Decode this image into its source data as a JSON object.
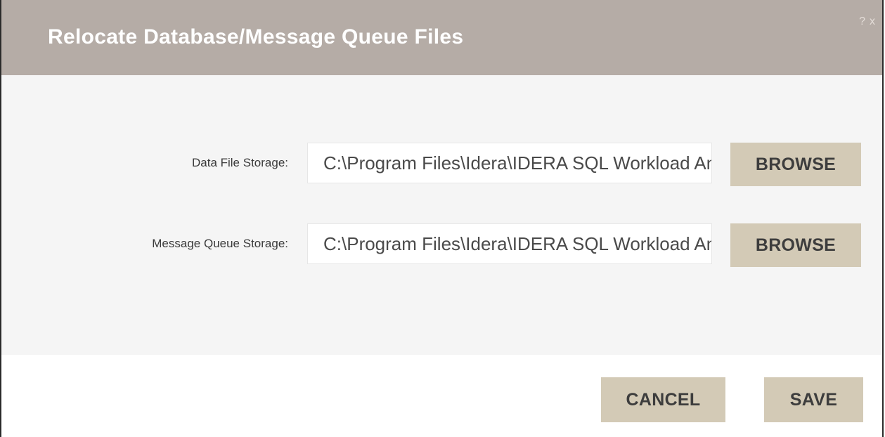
{
  "dialog": {
    "title": "Relocate Database/Message Queue Files",
    "help_glyph": "?",
    "close_glyph": "x"
  },
  "fields": [
    {
      "label": "Data File Storage:",
      "value": "C:\\Program Files\\Idera\\IDERA SQL Workload Analysis",
      "button_label": "BROWSE"
    },
    {
      "label": "Message Queue Storage:",
      "value": "C:\\Program Files\\Idera\\IDERA SQL Workload Analysis",
      "button_label": "BROWSE"
    }
  ],
  "footer": {
    "cancel_label": "CANCEL",
    "save_label": "SAVE"
  },
  "colors": {
    "title_bar": "#b5aca6",
    "button": "#d3cab6",
    "content_bg": "#f5f5f5"
  },
  "icons": {
    "help": "help-icon",
    "close": "close-icon"
  }
}
